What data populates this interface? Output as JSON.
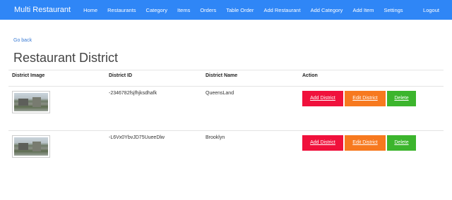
{
  "navbar": {
    "brand": "Multi Restaurant",
    "items": [
      "Home",
      "Restaurants",
      "Category",
      "Items",
      "Orders",
      "Table Order",
      "Add Restaurant",
      "Add Category",
      "Add Item",
      "Settings"
    ],
    "logout": "Logout",
    "color": "#2f86f6"
  },
  "page": {
    "go_back": "Go back",
    "title": "Restaurant District"
  },
  "table": {
    "headers": [
      "District Image",
      "District ID",
      "District Name",
      "Action"
    ],
    "rows": [
      {
        "district_id": "-2346782fsjfhjksdhafk",
        "district_name": "QueensLand"
      },
      {
        "district_id": "-L6Vx0YbvJD75UueeDlw",
        "district_name": "Brooklyn"
      }
    ],
    "actions": {
      "add": "Add District",
      "edit": "Edit District",
      "delete": "Delete"
    },
    "colors": {
      "add": "#f0113c",
      "edit": "#f7791f",
      "delete": "#3cb52d"
    }
  }
}
